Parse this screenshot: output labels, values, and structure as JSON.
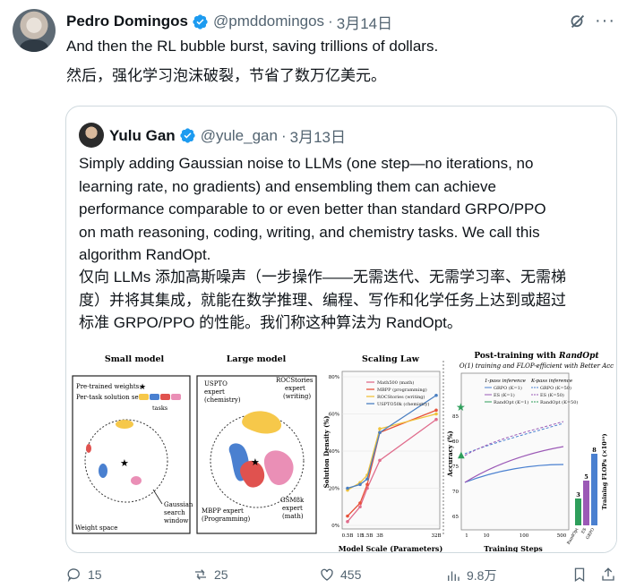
{
  "tweet": {
    "author_name": "Pedro Domingos",
    "handle": "@pmddomingos",
    "separator": "·",
    "date": "3月14日",
    "text_en": "And then the RL bubble burst, saving trillions of dollars.",
    "text_zh": "然后，强化学习泡沫破裂，节省了数万亿美元。",
    "menu_icon": "grok-icon",
    "more_icon": "more-dots-icon"
  },
  "quote": {
    "author_name": "Yulu Gan",
    "handle": "@yule_gan",
    "separator": "·",
    "date": "3月13日",
    "text_en_lines": [
      "Simply adding Gaussian noise to LLMs (one step—no iterations, no",
      "learning rate, no gradients) and ensembling them can achieve",
      "performance comparable to or even better than standard GRPO/PPO",
      "on math reasoning, coding, writing, and chemistry tasks. We call this",
      "algorithm RandOpt."
    ],
    "text_zh_lines": [
      "仅向 LLMs 添加高斯噪声（一步操作——无需迭代、无需学习率、无需梯",
      "度）并将其集成，就能在数学推理、编程、写作和化学任务上达到或超过",
      "标准 GRPO/PPO 的性能。我们称这种算法为 RandOpt。"
    ]
  },
  "figure": {
    "small_model": {
      "title": "Small model",
      "legend_pretrained": "Pre-trained weights:",
      "legend_per_task": "Per-task solution set:",
      "legend_tasks": "tasks",
      "gaussian_label_1": "Gaussian",
      "gaussian_label_2": "search",
      "gaussian_label_3": "window",
      "weight_space": "Weight space"
    },
    "large_model": {
      "title": "Large model",
      "uspto_1": "USPTO",
      "uspto_2": "expert",
      "uspto_3": "(chemistry)",
      "roc_1": "ROCStories",
      "roc_2": "expert",
      "roc_3": "(writing)",
      "mbpp_1": "MBPP expert",
      "mbpp_2": "(Programming)",
      "gsm_1": "GSM8k",
      "gsm_2": "expert",
      "gsm_3": "(math)"
    },
    "scaling": {
      "title": "Scaling Law",
      "ylabel": "Solution Density (%)",
      "xlabel": "Model Scale (Parameters)",
      "yticks": [
        "0%",
        "20%",
        "40%",
        "60%",
        "80%"
      ],
      "xticks": [
        "0.5B",
        "1B",
        "1.5B",
        "3B",
        "32B"
      ],
      "legend": [
        "Math500 (math)",
        "MBPP (programming)",
        "ROCStories (writing)",
        "USPTO50k (chemistry)"
      ]
    },
    "post": {
      "title_pre": "Post-training with ",
      "title_em": "RandOpt",
      "subtitle": "O(1) training and FLOP-efficient with Better Acc",
      "col1": "1-pass inference",
      "col2": "K-pass inference",
      "leg": [
        "GRPO (K=1)",
        "ES (K=1)",
        "RandOpt (K=1)",
        "GRPO (K=50)",
        "ES (K=50)",
        "RandOpt (K=50)"
      ],
      "ylabel": "Accuracy (%)",
      "xlabel": "Training Steps",
      "yticks": [
        "65",
        "70",
        "75",
        "80",
        "85"
      ],
      "xticks": [
        "1",
        "10",
        "100",
        "500"
      ],
      "flops_label": "Training FLOPs (×10¹⁹)",
      "bar_values": [
        "3",
        "5",
        "8"
      ],
      "bar_names": [
        "RandOpt",
        "ES",
        "GRPO"
      ]
    }
  },
  "chart_data": [
    {
      "type": "line",
      "title": "Scaling Law",
      "xlabel": "Model Scale (Parameters)",
      "ylabel": "Solution Density (%)",
      "categories": [
        "0.5B",
        "1B",
        "1.5B",
        "3B",
        "32B"
      ],
      "ylim": [
        0,
        80
      ],
      "series": [
        {
          "name": "Math500 (math)",
          "color": "#e06c8c",
          "values": [
            2,
            10,
            20,
            35,
            57
          ]
        },
        {
          "name": "MBPP (programming)",
          "color": "#e8523b",
          "values": [
            5,
            12,
            22,
            50,
            62
          ]
        },
        {
          "name": "ROCStories (writing)",
          "color": "#f0c33c",
          "values": [
            19,
            23,
            27,
            52,
            60
          ]
        },
        {
          "name": "USPTO50k (chemistry)",
          "color": "#4a7fc1",
          "values": [
            20,
            22,
            25,
            50,
            70
          ]
        }
      ]
    },
    {
      "type": "bar",
      "title": "Training FLOPs (×10¹⁹)",
      "categories": [
        "RandOpt",
        "ES",
        "GRPO"
      ],
      "values": [
        3,
        5,
        8
      ]
    }
  ],
  "actions": {
    "replies": "15",
    "reposts": "25",
    "likes": "455",
    "views": "9.8万"
  }
}
